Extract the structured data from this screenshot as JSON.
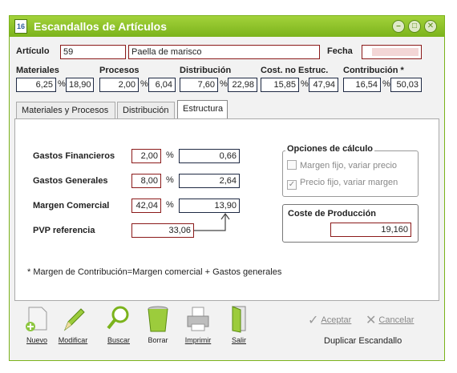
{
  "window": {
    "title": "Escandallos de Artículos",
    "icon_text": "16"
  },
  "header": {
    "articulo_label": "Artículo",
    "articulo_code": "59",
    "articulo_name": "Paella de marisco",
    "fecha_label": "Fecha",
    "fecha_value": ""
  },
  "summary": {
    "materiales": {
      "label": "Materiales",
      "pct": "6,25",
      "value": "18,90"
    },
    "procesos": {
      "label": "Procesos",
      "pct": "2,00",
      "value": "6,04"
    },
    "distribucion": {
      "label": "Distribución",
      "pct": "7,60",
      "value": "22,98"
    },
    "cost_no_estruc": {
      "label": "Cost. no Estruc.",
      "pct": "15,85",
      "value": "47,94"
    },
    "contribucion": {
      "label": "Contribución *",
      "pct": "16,54",
      "value": "50,03"
    },
    "pct_sign": "%"
  },
  "tabs": [
    {
      "label": "Materiales y Procesos"
    },
    {
      "label": "Distribución"
    },
    {
      "label": "Estructura"
    }
  ],
  "estructura": {
    "gastos_financieros": {
      "label": "Gastos Financieros",
      "pct": "2,00",
      "value": "0,66"
    },
    "gastos_generales": {
      "label": "Gastos Generales",
      "pct": "8,00",
      "value": "2,64"
    },
    "margen_comercial": {
      "label": "Margen Comercial",
      "pct": "42,04",
      "value": "13,90"
    },
    "pvp_referencia": {
      "label": "PVP referencia",
      "value": "33,06"
    },
    "opciones": {
      "title": "Opciones de cálculo",
      "margen_fijo": "Margen fijo, variar precio",
      "precio_fijo": "Precio fijo, variar margen",
      "precio_fijo_checked": true
    },
    "coste": {
      "title": "Coste de Producción",
      "value": "19,160"
    },
    "note": "* Margen de Contribución=Margen comercial + Gastos generales"
  },
  "toolbar": {
    "nuevo": "Nuevo",
    "modificar": "Modificar",
    "buscar": "Buscar",
    "borrar": "Borrar",
    "imprimir": "Imprimir",
    "salir": "Salir"
  },
  "actions": {
    "aceptar": "Aceptar",
    "cancelar": "Cancelar",
    "duplicar": "Duplicar Escandallo"
  }
}
